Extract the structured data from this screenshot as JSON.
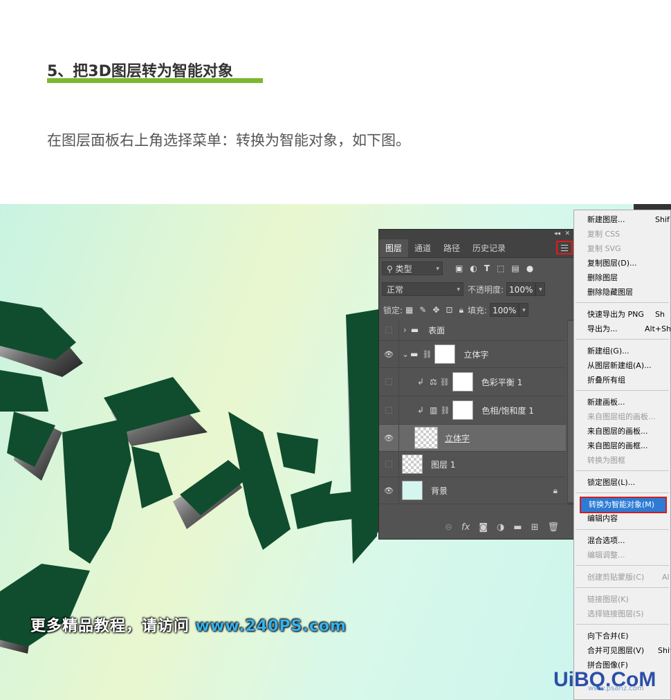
{
  "article": {
    "heading": "5、把3D图层转为智能对象",
    "intro": "在图层面板右上角选择菜单：转换为智能对象，如下图。"
  },
  "promo": {
    "text": "更多精品教程，请访问 ",
    "url": "www.240PS.com"
  },
  "panel": {
    "collapse": "◂◂",
    "close": "✕",
    "tabs": [
      "图层",
      "通道",
      "路径",
      "历史记录"
    ],
    "filter": {
      "value": "类型"
    },
    "blend": {
      "value": "正常",
      "opacity_label": "不透明度:",
      "opacity": "100%"
    },
    "lock": {
      "label": "锁定:",
      "fill_label": "填充:",
      "fill": "100%"
    },
    "layers": [
      {
        "name": "表面",
        "visible": false,
        "kind": "group-collapsed"
      },
      {
        "name": "立体字",
        "visible": true,
        "kind": "group-open"
      },
      {
        "name": "色彩平衡 1",
        "visible": false,
        "kind": "adjustment"
      },
      {
        "name": "色相/饱和度 1",
        "visible": false,
        "kind": "adjustment"
      },
      {
        "name": "立体字",
        "visible": true,
        "kind": "3d",
        "selected": true
      },
      {
        "name": "图层 1",
        "visible": false,
        "kind": "pixel"
      },
      {
        "name": "背景",
        "visible": true,
        "kind": "background"
      }
    ]
  },
  "menu": {
    "items": [
      {
        "label": "新建图层...",
        "shortcut": "Shif",
        "disabled": false
      },
      {
        "label": "复制 CSS",
        "shortcut": "",
        "disabled": true
      },
      {
        "label": "复制 SVG",
        "shortcut": "",
        "disabled": true
      },
      {
        "label": "复制图层(D)...",
        "shortcut": "",
        "disabled": false
      },
      {
        "label": "删除图层",
        "shortcut": "",
        "disabled": false
      },
      {
        "label": "删除隐藏图层",
        "shortcut": "",
        "disabled": false
      },
      {
        "label": "快速导出为 PNG",
        "shortcut": "Sh",
        "disabled": false
      },
      {
        "label": "导出为...",
        "shortcut": "Alt+Sh",
        "disabled": false
      },
      {
        "label": "新建组(G)...",
        "shortcut": "",
        "disabled": false
      },
      {
        "label": "从图层新建组(A)...",
        "shortcut": "",
        "disabled": false
      },
      {
        "label": "折叠所有组",
        "shortcut": "",
        "disabled": false
      },
      {
        "label": "新建画板...",
        "shortcut": "",
        "disabled": false
      },
      {
        "label": "来自图层组的画板...",
        "shortcut": "",
        "disabled": true
      },
      {
        "label": "来自图层的画板...",
        "shortcut": "",
        "disabled": false
      },
      {
        "label": "来自图层的画框...",
        "shortcut": "",
        "disabled": false
      },
      {
        "label": "转换为图框",
        "shortcut": "",
        "disabled": true
      },
      {
        "label": "锁定图层(L)...",
        "shortcut": "",
        "disabled": false
      },
      {
        "label": "转换为智能对象(M)",
        "shortcut": "",
        "disabled": false,
        "highlighted": true
      },
      {
        "label": "编辑内容",
        "shortcut": "",
        "disabled": false
      },
      {
        "label": "混合选项...",
        "shortcut": "",
        "disabled": false
      },
      {
        "label": "编辑调整...",
        "shortcut": "",
        "disabled": true
      },
      {
        "label": "创建剪贴蒙版(C)",
        "shortcut": "Al",
        "disabled": true
      },
      {
        "label": "链接图层(K)",
        "shortcut": "",
        "disabled": true
      },
      {
        "label": "选择链接图层(S)",
        "shortcut": "",
        "disabled": true
      },
      {
        "label": "向下合并(E)",
        "shortcut": "",
        "disabled": false
      },
      {
        "label": "合并可见图层(V)",
        "shortcut": "Shif",
        "disabled": false
      },
      {
        "label": "拼合图像(F)",
        "shortcut": "",
        "disabled": false
      }
    ]
  },
  "watermark": {
    "text": "UiBQ.CoM",
    "sub": "www.psahz.com"
  },
  "colors": {
    "accent_underline": "#7cb82f",
    "highlight": "#2d7bd5",
    "annotation_red": "#e31b1b",
    "art_green": "#0f4d2e"
  }
}
